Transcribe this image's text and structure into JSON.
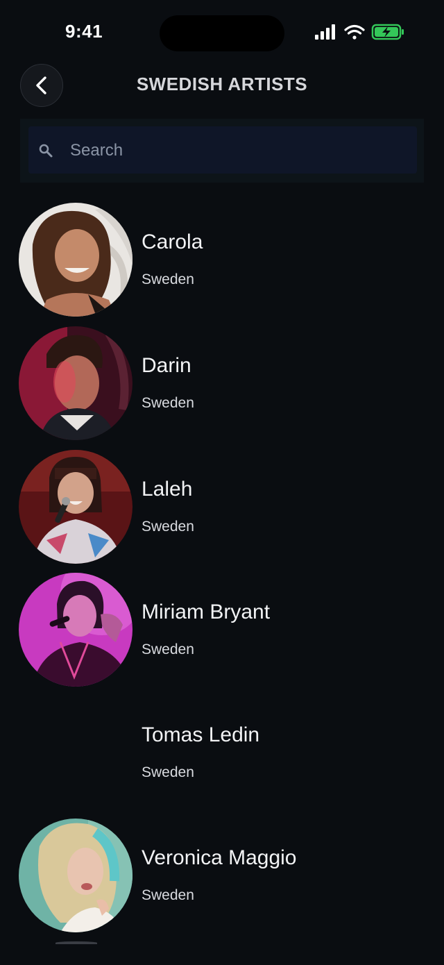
{
  "status_bar": {
    "time": "9:41",
    "icons": [
      "cellular-signal-icon",
      "wifi-icon",
      "battery-charging-icon"
    ],
    "battery_color": "#34c759"
  },
  "header": {
    "back_icon": "chevron-left-icon",
    "title": "SWEDISH ARTISTS"
  },
  "search": {
    "icon": "search-icon",
    "placeholder": "Search",
    "value": ""
  },
  "artists": [
    {
      "name": "Carola",
      "country": "Sweden",
      "has_photo": true
    },
    {
      "name": "Darin",
      "country": "Sweden",
      "has_photo": true
    },
    {
      "name": "Laleh",
      "country": "Sweden",
      "has_photo": true
    },
    {
      "name": "Miriam Bryant",
      "country": "Sweden",
      "has_photo": true
    },
    {
      "name": "Tomas Ledin",
      "country": "Sweden",
      "has_photo": false
    },
    {
      "name": "Veronica Maggio",
      "country": "Sweden",
      "has_photo": true
    }
  ],
  "colors": {
    "background": "#0a0d11",
    "search_field": "#0f1628",
    "title_text": "#d6d7db",
    "placeholder": "#8b95a6"
  }
}
